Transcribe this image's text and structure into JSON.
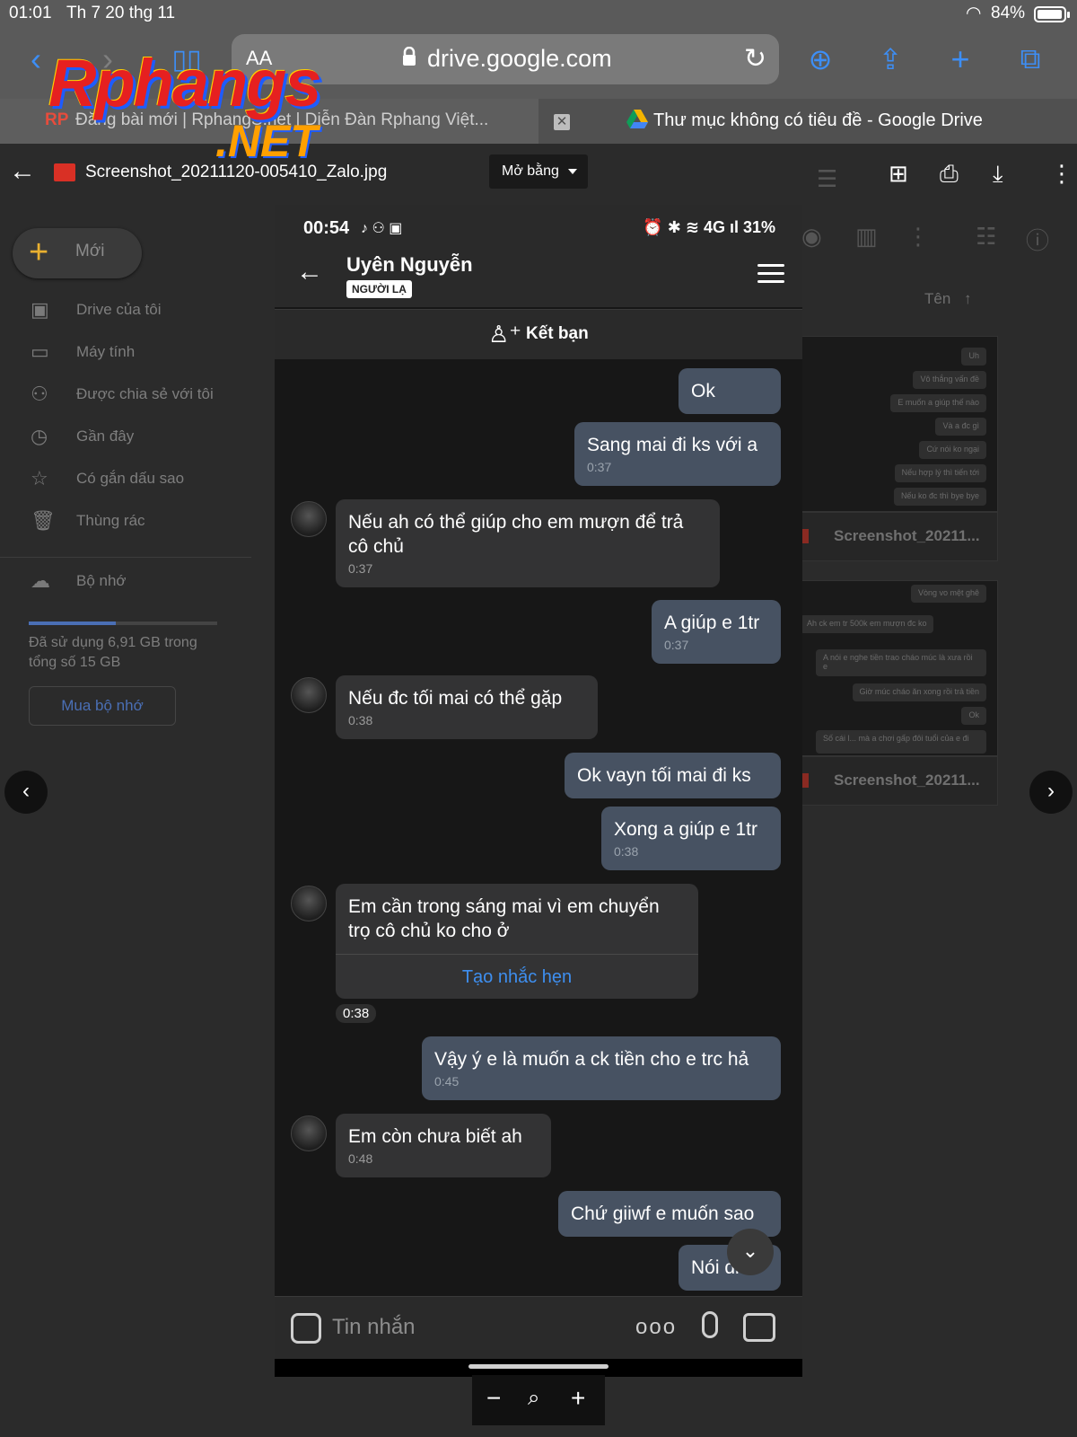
{
  "ios_status": {
    "time": "01:01",
    "date": "Th 7 20 thg 11",
    "battery": "84%",
    "battery_level": 0.84
  },
  "safari": {
    "aa_label": "AA",
    "url": "drive.google.com",
    "tabs": [
      {
        "label": "Đăng bài mới | RphangS.net | Diễn Đàn Rphang Việt...",
        "icon": "RP"
      },
      {
        "label": "Thư mục không có tiêu đề - Google Drive",
        "icon": "google-drive-icon"
      }
    ]
  },
  "watermark": {
    "logo": "Rphangs",
    "logo_suffix": ".NET"
  },
  "drive": {
    "new_label": "Mới",
    "nav": [
      {
        "label": "Drive của tôi",
        "icon": "my-drive-icon"
      },
      {
        "label": "Máy tính",
        "icon": "computer-icon"
      },
      {
        "label": "Được chia sẻ với tôi",
        "icon": "shared-icon"
      },
      {
        "label": "Gần đây",
        "icon": "clock-icon"
      },
      {
        "label": "Có gắn dấu sao",
        "icon": "star-icon"
      },
      {
        "label": "Thùng rác",
        "icon": "trash-icon"
      }
    ],
    "storage_label": "Bộ nhớ",
    "storage_used_fraction": 0.46,
    "storage_text": "Đã sử dụng 6,91 GB trong tổng số 15 GB",
    "buy_storage": "Mua bộ nhớ",
    "sort_label": "Tên",
    "files": [
      {
        "name": "Screenshot_20211...",
        "preview": [
          "Uh",
          "Vô thắng vấn đề",
          "E muốn a giúp thế nào",
          "Và a đc gì",
          "Cứ nói ko ngại",
          "Nếu hợp lý thì tiến tới",
          "Nếu ko đc thì bye bye"
        ]
      },
      {
        "name": "Screenshot_20211...",
        "preview": [
          "Vòng vo mệt ghê",
          "Ah ck em tr 500k em mượn đc ko",
          "A nói e nghe tiền trao cháo múc là xưa rồi e",
          "Giờ múc cháo ăn xong rồi trả tiền",
          "Ok",
          "Số cái l... mà a chơi gấp đôi tuổi của e đi"
        ]
      }
    ]
  },
  "viewer": {
    "filename": "Screenshot_20211120-005410_Zalo.jpg",
    "open_with": "Mở bằng"
  },
  "zalo": {
    "status_time": "00:54",
    "status_right": "31%",
    "contact_name": "Uyên Nguyễn",
    "contact_badge": "NGƯỜI LẠ",
    "add_friend": "Kết bạn",
    "messages": [
      {
        "dir": "out",
        "text": "Ok",
        "time": ""
      },
      {
        "dir": "out",
        "text": "Sang mai đi ks với a",
        "time": "0:37"
      },
      {
        "dir": "in",
        "text": "Nếu ah có thể giúp cho em mượn để trả cô chủ",
        "time": "0:37"
      },
      {
        "dir": "out",
        "text": "A giúp e 1tr",
        "time": "0:37"
      },
      {
        "dir": "in",
        "text": "Nếu đc tối mai có thể gặp",
        "time": "0:38"
      },
      {
        "dir": "out",
        "text": "Ok vayn tối mai đi ks",
        "time": ""
      },
      {
        "dir": "out",
        "text": "Xong a giúp e 1tr",
        "time": "0:38"
      },
      {
        "dir": "in",
        "text": "Em cần trong sáng mai vì em chuyển trọ cô chủ ko cho ở",
        "time": "0:38",
        "action": "Tạo nhắc hẹn"
      },
      {
        "dir": "out",
        "text": "Vậy ý e là muốn a ck tiền cho e trc hả",
        "time": "0:45"
      },
      {
        "dir": "in",
        "text": "Em còn chưa biết ah",
        "time": "0:48"
      },
      {
        "dir": "out",
        "text": "Chứ giiwf e muốn sao",
        "time": ""
      },
      {
        "dir": "out",
        "text": "Nói đi",
        "time": ""
      }
    ],
    "composer_placeholder": "Tin nhắn",
    "composer_more": "ooo"
  }
}
